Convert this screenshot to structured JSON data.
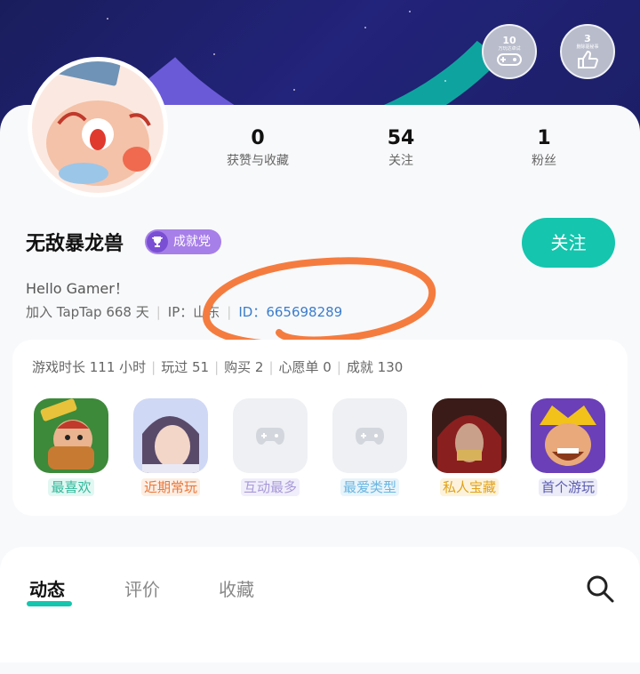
{
  "badges": [
    {
      "num": "10",
      "caption": "万玩达卓试"
    },
    {
      "num": "3",
      "caption": "删除驱秘事"
    }
  ],
  "stats": [
    {
      "value": "0",
      "label": "获赞与收藏"
    },
    {
      "value": "54",
      "label": "关注"
    },
    {
      "value": "1",
      "label": "粉丝"
    }
  ],
  "profile": {
    "name": "无敌暴龙兽",
    "achievement_label": "成就党",
    "follow_label": "关注",
    "bio": "Hello Gamer！",
    "joined": "加入 TapTap 668 天",
    "ip": "IP：山东",
    "uid": "ID：665698289"
  },
  "game_stats": [
    "游戏时长 111 小时",
    "玩过 51",
    "购买 2",
    "心愿单 0",
    "成就 130"
  ],
  "games": [
    {
      "label": "最喜欢",
      "color": "#2fb89b",
      "bg": "#e2f7f2",
      "icon": "shawarma-game-icon"
    },
    {
      "label": "近期常玩",
      "color": "#e8783a",
      "bg": "#fdeee4",
      "icon": "romance-game-icon"
    },
    {
      "label": "互动最多",
      "color": "#a89ad8",
      "bg": "#f1eefb",
      "icon": "gamepad-placeholder-icon"
    },
    {
      "label": "最爱类型",
      "color": "#6bb6e0",
      "bg": "#e8f4fb",
      "icon": "gamepad-placeholder-icon"
    },
    {
      "label": "私人宝藏",
      "color": "#e0a21a",
      "bg": "#fdf3dc",
      "icon": "assassin-game-icon"
    },
    {
      "label": "首个游玩",
      "color": "#5a5bb0",
      "bg": "#ececf8",
      "icon": "clash-game-icon"
    }
  ],
  "tabs": [
    "动态",
    "评价",
    "收藏"
  ],
  "colors": {
    "accent": "#15c5ad",
    "achievement": "#a77fe8",
    "annotation": "#f57c3f"
  }
}
